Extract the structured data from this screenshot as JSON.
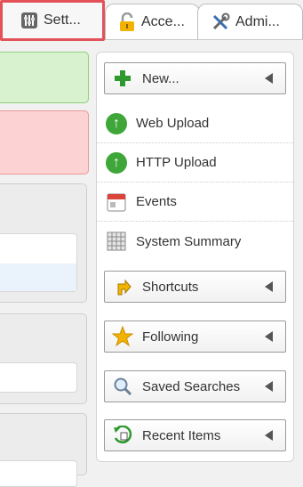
{
  "tabs": [
    {
      "label": "Sett..."
    },
    {
      "label": "Acce..."
    },
    {
      "label": "Admi..."
    }
  ],
  "menu": {
    "new_label": "New...",
    "web_upload": "Web Upload",
    "http_upload": "HTTP Upload",
    "events": "Events",
    "system_summary": "System Summary",
    "shortcuts": "Shortcuts",
    "following": "Following",
    "saved_searches": "Saved Searches",
    "recent_items": "Recent Items"
  },
  "colors": {
    "tab_highlight": "#e35259",
    "upload_icon": "#3fa639",
    "new_icon": "#2e9a2e",
    "star": "#f2b300"
  }
}
